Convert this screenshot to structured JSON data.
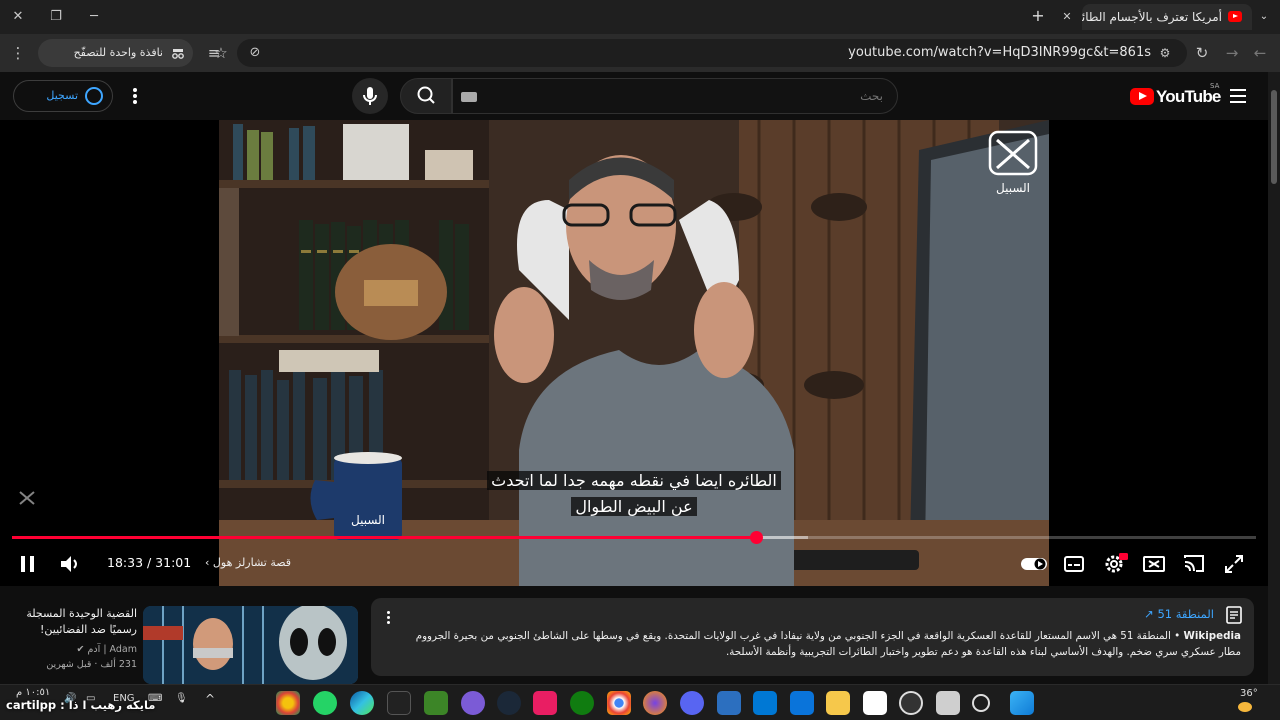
{
  "browser": {
    "tab_title": "أمريكا تعترف بالأجسام الطائرة",
    "url": "youtube.com/watch?v=HqD3INR99gc&t=861s",
    "incognito_label": "نافذة واحدة للتصفّح المتخفي"
  },
  "youtube": {
    "sign_in_label": "تسجيل الدخول",
    "search_placeholder": "بحث",
    "logo_word": "YouTube",
    "country_code": "SA"
  },
  "player": {
    "subtitle_line1": "الطائره ايضا في نقطه مهمه جدا لما اتحدث",
    "subtitle_line2": "عن البيض الطوال",
    "current_time": "18:33",
    "duration": "31:01",
    "time_display": "18:33 / 31:01",
    "chapter_label": "قصة تشارلز هول",
    "progress_fraction": 0.5983,
    "buffered_fraction": 0.64,
    "channel_watermark": "السبيل"
  },
  "recommendation": {
    "title": "القضية الوحيدة المسجلة رسميًا ضد الفضائيين!",
    "channel": "Adam | آدم",
    "views": "231 ألف",
    "age": "قبل شهرين"
  },
  "info_panel": {
    "title": "المنطقة 51",
    "source": "Wikipedia",
    "text": "المنطقة 51 هي الاسم المستعار للقاعدة العسكرية الواقعة في الجزء الجنوبي من ولاية نيفادا في غرب الولايات المتحدة. ويقع في وسطها على الشاطئ الجنوبي من بحيرة الجرووم مطار عسكري سري ضخم. والهدف الأساسي لبناء هذه القاعدة هو دعم تطوير واختبار الطائرات التجريبية وأنظمة الأسلحة."
  },
  "taskbar": {
    "language": "ENG",
    "temperature": "36°",
    "clock": "١٠:٥١ م",
    "overlay_text": "مايكه رهيب ا ذا : cartilpp"
  },
  "colors": {
    "accent_red": "#ff0033",
    "link_blue": "#3ea6ff",
    "background": "#0f0f0f"
  }
}
